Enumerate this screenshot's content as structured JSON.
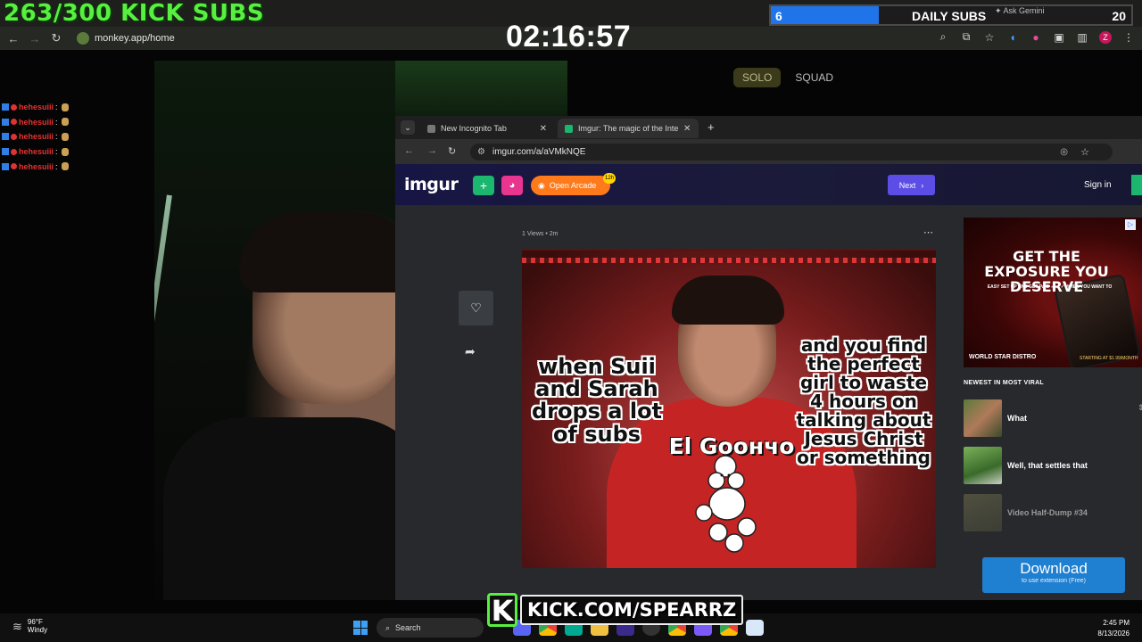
{
  "overlay": {
    "kick_subs_text": "263/300 KICK SUBS",
    "timer": "02:16:57",
    "daily_subs": {
      "current": "6",
      "label": "DAILY SUBS",
      "goal": "20",
      "progress_fraction": 0.3
    },
    "kick_url": "KICK.COM/SPEARRZ",
    "kick_letter": "K"
  },
  "outer_browser": {
    "url": "monkey.app/home",
    "ask_gemini": "Ask Gemini",
    "profile_letter": "Z",
    "icons": [
      "back-icon",
      "forward-icon",
      "reload-icon",
      "zoom-icon",
      "cast-icon",
      "star-icon",
      "extension-icon",
      "menu-icon"
    ]
  },
  "monkey_app": {
    "mode_solo": "SOLO",
    "mode_squad": "SQUAD"
  },
  "chat": [
    {
      "user": "hehesuiii",
      "sep": ":"
    },
    {
      "user": "hehesuiii",
      "sep": ":"
    },
    {
      "user": "hehesuiii",
      "sep": ":"
    },
    {
      "user": "hehesuiii",
      "sep": ":"
    },
    {
      "user": "hehesuiii",
      "sep": ":"
    }
  ],
  "inner_browser": {
    "tabs": [
      {
        "label": "New Incognito Tab"
      },
      {
        "label": "Imgur: The magic of the Interne"
      }
    ],
    "url": "imgur.com/a/aVMkNQE"
  },
  "imgur": {
    "logo": "imgur",
    "arcade_label": "Open Arcade",
    "arcade_badge": "12h",
    "next_label": "Next",
    "signin_label": "Sign in",
    "post_meta": "1 Views  •  2m",
    "meme": {
      "caption_left": "when Suii and Sarah drops a lot of subs",
      "caption_right": "and you find the perfect girl to waste 4 hours on talking about Jesus Christ or something",
      "caption_center": "El Goончo"
    },
    "ad": {
      "title": "GET THE EXPOSURE YOU DESERVE",
      "subtitle": "EASY SET UP AND GET PAID ✓ ✓ ✓ WHEN YOU WANT TO",
      "brand": "WORLD STAR   DISTRO",
      "price": "STARTING AT $1.99/MONTH"
    },
    "newest_title": "NEWEST IN MOST VIRAL",
    "viral_items": [
      {
        "title": "What"
      },
      {
        "title": "Well, that settles that"
      },
      {
        "title": "Video Half-Dump #34"
      }
    ],
    "download": {
      "label": "Download",
      "sub": "to use extension (Free)"
    }
  },
  "taskbar": {
    "temp": "96°F",
    "weather": "Windy",
    "search_label": "Search",
    "time": "2:45 PM",
    "date": "8/13/2026"
  }
}
